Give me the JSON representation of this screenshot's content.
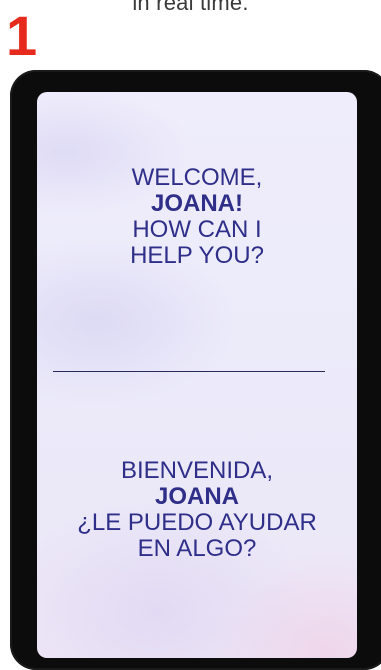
{
  "caption": "in real time.",
  "step_number": "1",
  "screen": {
    "english": {
      "line1": "WELCOME,",
      "name": "JOANA!",
      "line3": "HOW CAN I",
      "line4": "HELP YOU?"
    },
    "spanish": {
      "line1": "BIENVENIDA,",
      "name": "JOANA",
      "line3": "¿LE PUEDO AYUDAR",
      "line4": "EN ALGO?"
    }
  },
  "colors": {
    "accent": "#e62b1e",
    "text": "#2f2f8a",
    "device": "#0c0c0c"
  }
}
